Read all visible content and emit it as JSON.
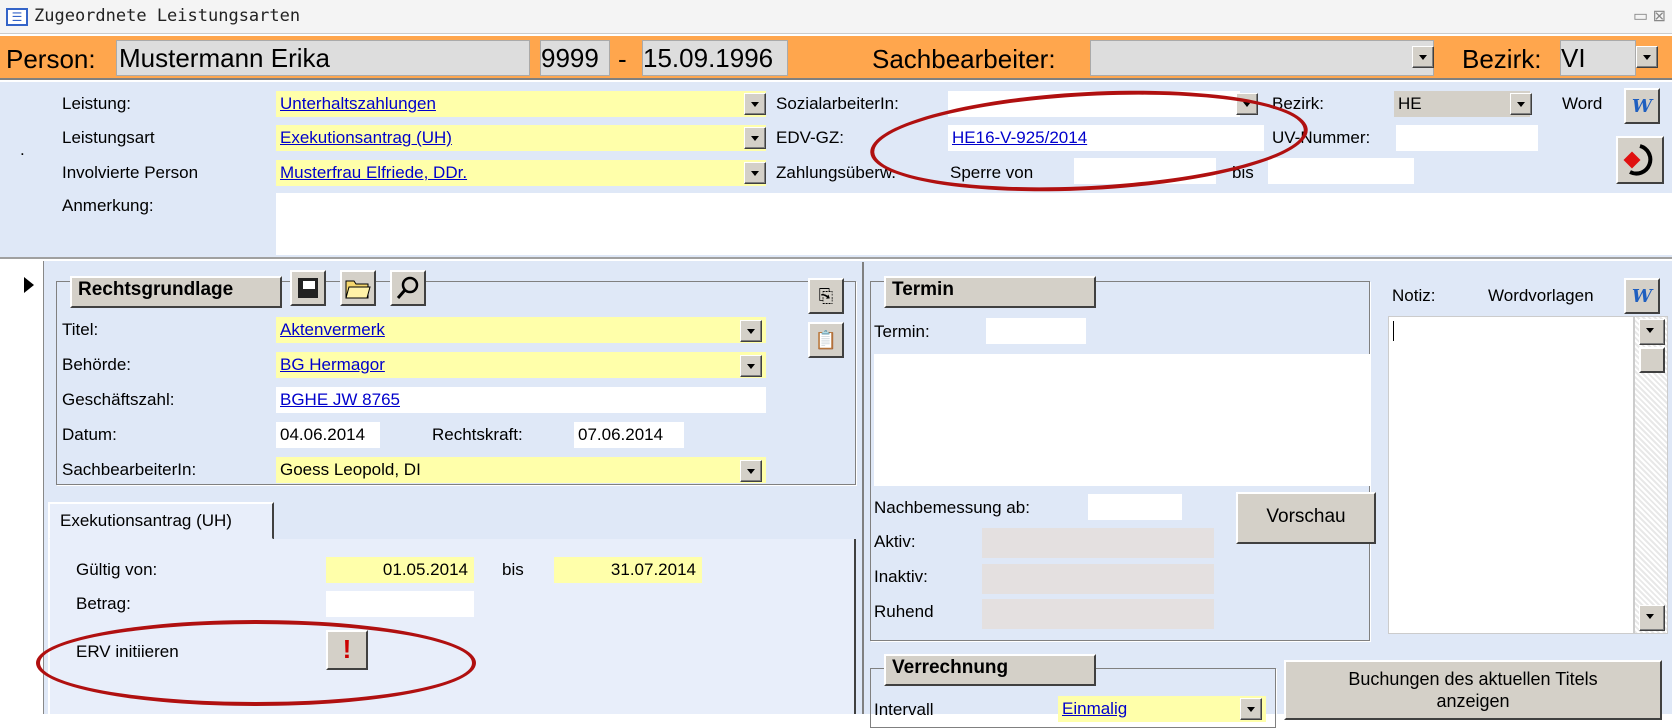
{
  "window": {
    "title": "Zugeordnete Leistungsarten",
    "controls": "▭ ⊠"
  },
  "header": {
    "person_label": "Person:",
    "person_name": "Mustermann Erika",
    "person_id": "9999",
    "sep": "-",
    "birthdate": "15.09.1996",
    "sachbearbeiter_label": "Sachbearbeiter:",
    "sachbearbeiter_value": "",
    "bezirk_label": "Bezirk:",
    "bezirk_value": "VI"
  },
  "top": {
    "leistung_label": "Leistung:",
    "leistung_value": "Unterhaltszahlungen",
    "leistungsart_label": "Leistungsart",
    "leistungsart_value": "Exekutionsantrag (UH)",
    "involviert_label": "Involvierte Person",
    "involviert_value": "Musterfrau Elfriede, DDr.",
    "anmerkung_label": "Anmerkung:",
    "anmerkung_value": "",
    "sozial_label": "SozialarbeiterIn:",
    "sozial_value": "",
    "edv_label": "EDV-GZ:",
    "edv_value": "HE16-V-925/2014",
    "zahlung_label": "Zahlungsüberw.",
    "sperre_label": "Sperre von",
    "sperre_value": "",
    "bis_label": "bis",
    "bis_value": "",
    "bezirk_label": "Bezirk:",
    "bezirk_value": "HE",
    "uv_label": "UV-Nummer:",
    "uv_value": "",
    "word_label": "Word",
    "dot": "."
  },
  "rechts": {
    "legend": "Rechtsgrundlage",
    "titel_label": "Titel:",
    "titel_value": "Aktenvermerk",
    "behoerde_label": "Behörde:",
    "behoerde_value": "BG Hermagor",
    "gz_label": "Geschäftszahl:",
    "gz_value": "BGHE JW  8765",
    "datum_label": "Datum:",
    "datum_value": "04.06.2014",
    "rk_label": "Rechtskraft:",
    "rk_value": "07.06.2014",
    "sb_label": "SachbearbeiterIn:",
    "sb_value": "Goess Leopold, DI"
  },
  "tab": {
    "label": "Exekutionsantrag (UH)",
    "gueltig_label": "Gültig von:",
    "gueltig_von": "01.05.2014",
    "bis_label": "bis",
    "gueltig_bis": "31.07.2014",
    "betrag_label": "Betrag:",
    "betrag_value": "",
    "erv_label": "ERV initiieren",
    "erv_button": "!"
  },
  "termin": {
    "legend": "Termin",
    "termin_label": "Termin:",
    "termin_value": "",
    "nach_label": "Nachbemessung ab:",
    "nach_value": "",
    "vorschau": "Vorschau",
    "aktiv_label": "Aktiv:",
    "inaktiv_label": "Inaktiv:",
    "ruhend_label": "Ruhend"
  },
  "notiz": {
    "label": "Notiz:",
    "wordvorlagen": "Wordvorlagen"
  },
  "verrechnung": {
    "legend": "Verrechnung",
    "intervall_label": "Intervall",
    "intervall_value": "Einmalig",
    "buchungen": "Buchungen des aktuellen Titels anzeigen"
  }
}
